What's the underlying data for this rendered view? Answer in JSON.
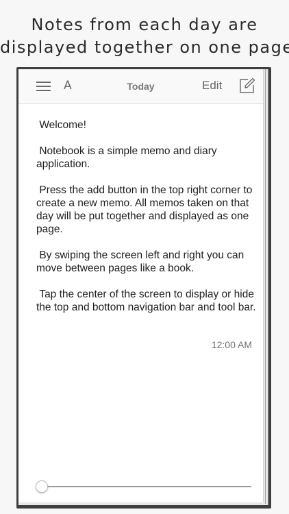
{
  "caption": {
    "line1": "Notes from each day are",
    "line2": "displayed together on one page."
  },
  "navbar": {
    "menu_icon": "hamburger-menu-icon",
    "font_label": "A",
    "title": "Today",
    "edit_label": "Edit",
    "compose_icon": "compose-icon"
  },
  "memo": {
    "paragraphs": [
      " Welcome!",
      " Notebook is a simple memo and diary application.",
      " Press the add button in the top right corner to create a new memo. All memos taken on that day will be put together and displayed as one page.",
      " By swiping the screen left and right you can move between pages like a book.",
      " Tap the center of the screen to display or hide the top and bottom navigation bar and tool bar."
    ],
    "time": "12:00 AM"
  },
  "page_slider": {
    "value": 0
  },
  "colors": {
    "book_cover": "#3f3f3f",
    "page": "#ffffff",
    "navbar": "#f9f9f9",
    "text": "#1e1e1e"
  }
}
